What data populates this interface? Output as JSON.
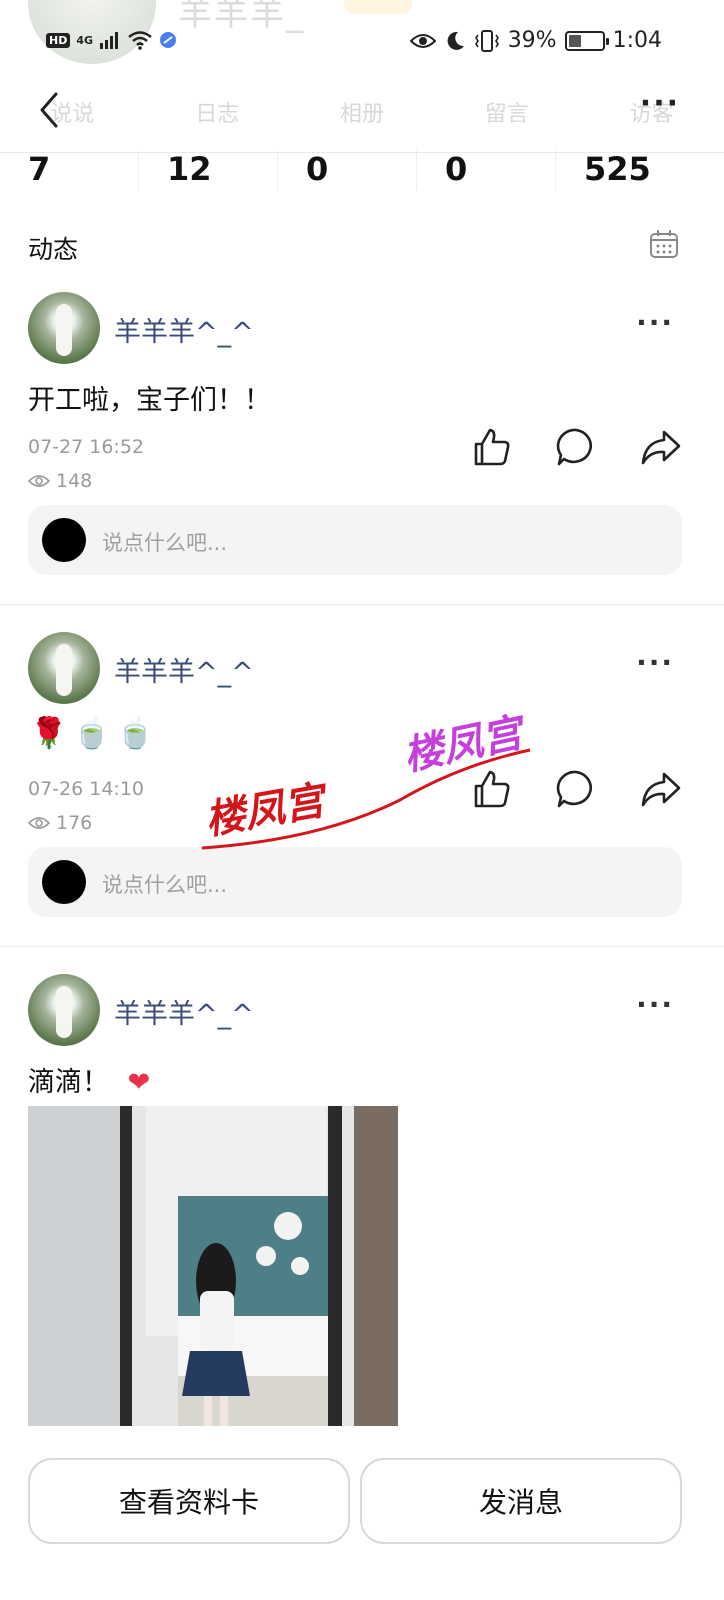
{
  "status_bar": {
    "hd": "HD",
    "network": "4G",
    "battery_percent": "39%",
    "battery_level": 0.39,
    "time": "1:04"
  },
  "profile_ghost": {
    "name": "羊羊羊_"
  },
  "nav": {
    "tabs": [
      "说说",
      "日志",
      "相册",
      "留言",
      "访客"
    ],
    "more": "···"
  },
  "counts": [
    "7",
    "12",
    "0",
    "0",
    "525"
  ],
  "section": {
    "title": "动态"
  },
  "posts": [
    {
      "username": "羊羊羊^_^",
      "text": "开工啦，宝子们！！",
      "time": "07-27 16:52",
      "views": "148",
      "comment_placeholder": "说点什么吧..."
    },
    {
      "username": "羊羊羊^_^",
      "emojis": [
        "🌹",
        "🍵",
        "🍵"
      ],
      "time": "07-26 14:10",
      "views": "176",
      "comment_placeholder": "说点什么吧..."
    },
    {
      "username": "羊羊羊^_^",
      "text": "滴滴！",
      "emoji": "❤"
    }
  ],
  "watermark": {
    "text1": "楼凤宫",
    "text2": "楼凤宫"
  },
  "bottom": {
    "profile_card": "查看资料卡",
    "message": "发消息"
  },
  "colors": {
    "username": "#3a4c77",
    "watermark_red": "#d4161b",
    "watermark_purple": "#c43fdc"
  }
}
